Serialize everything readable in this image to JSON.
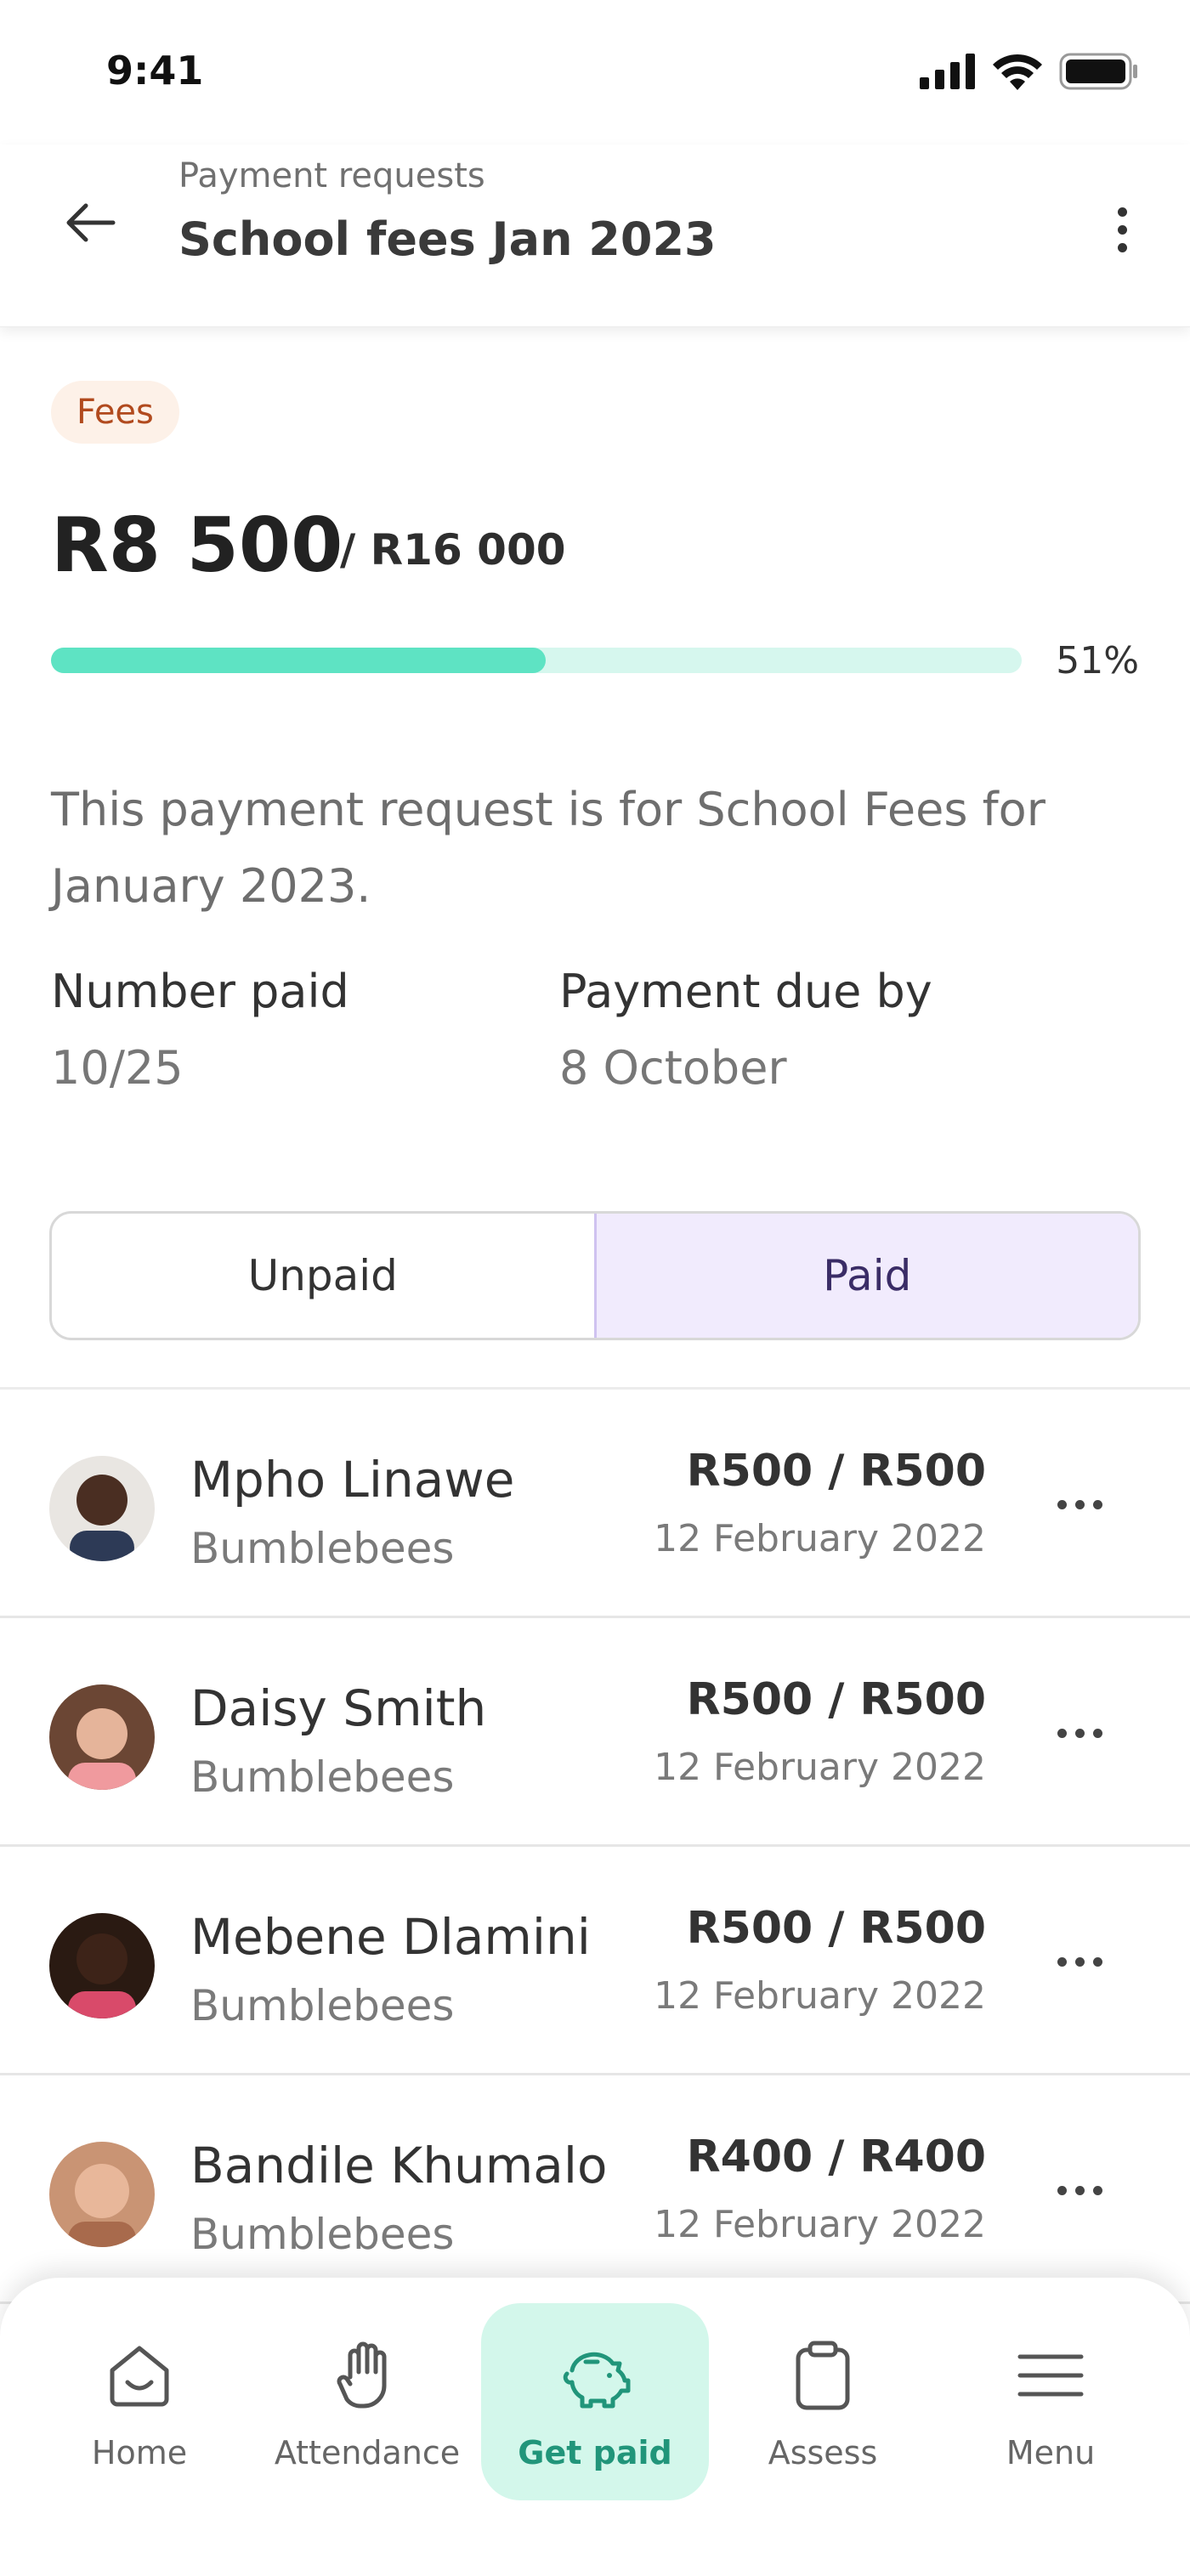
{
  "status_bar": {
    "time": "9:41"
  },
  "header": {
    "subtitle": "Payment requests",
    "title": "School fees Jan 2023"
  },
  "badge": {
    "label": "Fees",
    "bg": "#fdf1e8",
    "color": "#b14a1e"
  },
  "summary": {
    "amount_collected": "R8 500",
    "amount_total": "/ R16 000",
    "progress_fraction": 0.51,
    "progress_label": "51%",
    "description": "This payment request is for School Fees for January 2023.",
    "number_paid_label": "Number paid",
    "number_paid_value": "10/25",
    "due_label": "Payment due by",
    "due_value": "8 October"
  },
  "tabs": [
    {
      "label": "Unpaid",
      "active": false
    },
    {
      "label": "Paid",
      "active": true
    }
  ],
  "payments": [
    {
      "name": "Mpho Linawe",
      "class": "Bumblebees",
      "amount": "R500 / R500",
      "date": "12 February 2022",
      "avatar_color": "#5b3a2a"
    },
    {
      "name": "Daisy Smith",
      "class": "Bumblebees",
      "amount": "R500 / R500",
      "date": "12 February 2022",
      "avatar_color": "#7a4a35"
    },
    {
      "name": "Mebene Dlamini",
      "class": "Bumblebees",
      "amount": "R500 / R500",
      "date": "12 February 2022",
      "avatar_color": "#3b2418"
    },
    {
      "name": "Bandile Khumalo",
      "class": "Bumblebees",
      "amount": "R400 / R400",
      "date": "12 February 2022",
      "avatar_color": "#c98f6e"
    }
  ],
  "nav": [
    {
      "label": "Home",
      "icon": "home-icon",
      "active": false
    },
    {
      "label": "Attendance",
      "icon": "hand-icon",
      "active": false
    },
    {
      "label": "Get paid",
      "icon": "piggy-bank-icon",
      "active": true
    },
    {
      "label": "Assess",
      "icon": "clipboard-icon",
      "active": false
    },
    {
      "label": "Menu",
      "icon": "menu-icon",
      "active": false
    }
  ],
  "colors": {
    "accent": "#5ee3c3",
    "accent_light": "#d6f7ee",
    "nav_active_bg": "#d3f7eb",
    "tab_active_bg": "#f1ebfd"
  }
}
